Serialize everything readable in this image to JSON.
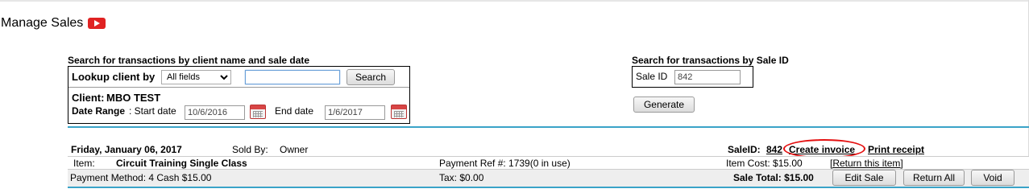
{
  "page": {
    "title": "Manage Sales",
    "youtube_icon": "youtube-icon"
  },
  "search_client": {
    "heading": "Search for transactions by client name and sale date",
    "lookup_label": "Lookup client by",
    "lookup_selected": "All fields",
    "lookup_value": "",
    "search_label": "Search",
    "client_label": "Client:",
    "client_name": "MBO TEST",
    "date_range_label": "Date Range",
    "start_label": ": Start date",
    "start_date": "10/6/2016",
    "end_label": "End date",
    "end_date": "1/6/2017",
    "calendar_icon": "calendar-icon"
  },
  "search_sale": {
    "heading": "Search for transactions by Sale ID",
    "sale_id_label": "Sale ID",
    "sale_id_value": "842",
    "generate_label": "Generate"
  },
  "sale": {
    "date": "Friday, January 06, 2017",
    "sold_by_label": "Sold By:",
    "sold_by": "Owner",
    "sale_id_label": "SaleID:",
    "sale_id": "842",
    "create_invoice": "Create invoice",
    "print_receipt": "Print receipt",
    "item_label": "Item:",
    "item_name": "Circuit Training Single Class",
    "payment_ref": "Payment Ref #:  1739(0 in use)",
    "item_cost": "Item Cost: $15.00",
    "return_item": "[Return this item]",
    "payment_method": "Payment Method:  4 Cash  $15.00",
    "tax": "Tax: $0.00",
    "sale_total": "Sale Total: $15.00",
    "edit_sale": "Edit Sale",
    "return_all": "Return All",
    "void": "Void"
  },
  "colors": {
    "accent_line": "#3aa3c8",
    "annotation": "#e41010"
  }
}
